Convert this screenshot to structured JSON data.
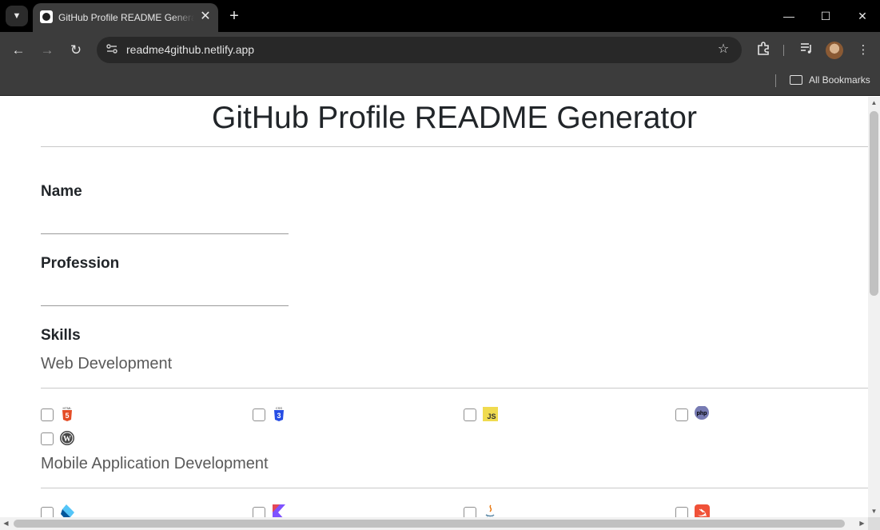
{
  "browser": {
    "tab_title": "GitHub Profile README Generator",
    "tab_close": "✕",
    "new_tab": "+",
    "url": "readme4github.netlify.app",
    "bookmarks_label": "All Bookmarks",
    "window_controls": {
      "minimize": "—",
      "maximize": "☐",
      "close": "✕"
    },
    "icons": [
      "tab-search-icon",
      "github-favicon-icon",
      "back-icon",
      "forward-icon",
      "reload-icon",
      "site-info-icon",
      "bookmark-star-icon",
      "extensions-icon",
      "media-queue-icon",
      "kebab-menu-icon",
      "folder-icon"
    ]
  },
  "page": {
    "title": "GitHub Profile README Generator",
    "name_label": "Name",
    "name_value": "",
    "profession_label": "Profession",
    "profession_value": "",
    "skills_label": "Skills",
    "categories": [
      {
        "name": "Web Development",
        "skills": [
          {
            "id": "html5",
            "checked": false,
            "logo_text": "5",
            "color": "#e44d26"
          },
          {
            "id": "css3",
            "checked": false,
            "logo_text": "3",
            "color": "#264de4"
          },
          {
            "id": "javascript",
            "checked": false,
            "logo_text": "JS",
            "color": "#f0db4f"
          },
          {
            "id": "php",
            "checked": false,
            "logo_text": "php",
            "color": "#777bb3"
          },
          {
            "id": "wordpress",
            "checked": false,
            "logo_text": "W",
            "color": "#464646"
          }
        ]
      },
      {
        "name": "Mobile Application Development",
        "skills": [
          {
            "id": "flutter",
            "checked": false,
            "color": "#02569b"
          },
          {
            "id": "kotlin",
            "checked": false,
            "color": "#7f52ff"
          },
          {
            "id": "java",
            "checked": false,
            "color": "#e76f00"
          },
          {
            "id": "swift",
            "checked": false,
            "color": "#f05138"
          }
        ]
      }
    ]
  }
}
